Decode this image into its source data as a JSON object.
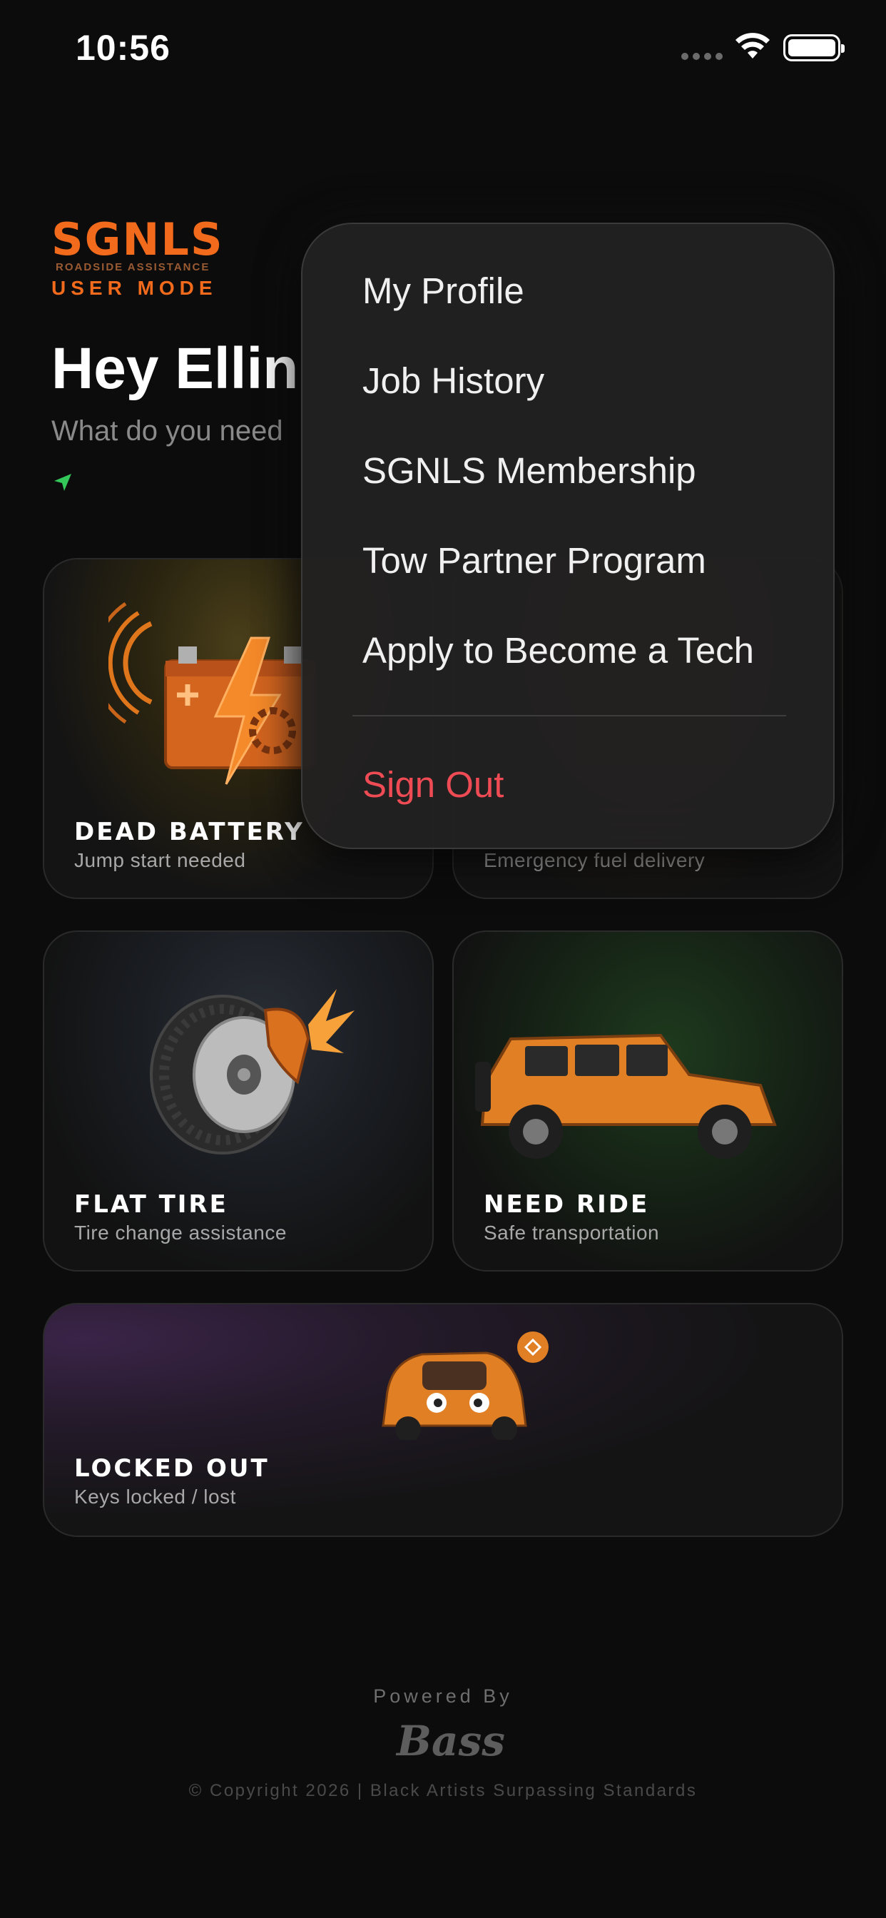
{
  "status_bar": {
    "time": "10:56"
  },
  "header": {
    "brand_name": "SGNLS",
    "brand_tagline": "ROADSIDE ASSISTANCE",
    "mode_label": "USER MODE",
    "greeting": "Hey Ellin",
    "prompt": "What do you need"
  },
  "services": [
    {
      "title": "DEAD BATTERY",
      "subtitle": "Jump start needed"
    },
    {
      "title": "",
      "subtitle": "Emergency fuel delivery"
    },
    {
      "title": "FLAT TIRE",
      "subtitle": "Tire change assistance"
    },
    {
      "title": "NEED RIDE",
      "subtitle": "Safe transportation"
    },
    {
      "title": "LOCKED OUT",
      "subtitle": "Keys locked / lost"
    }
  ],
  "menu": {
    "items": [
      "My Profile",
      "Job History",
      "SGNLS Membership",
      "Tow Partner Program",
      "Apply to Become a Tech"
    ],
    "sign_out": "Sign Out"
  },
  "footer": {
    "powered_by": "Powered By",
    "partner_logo": "Bass",
    "copyright": "© Copyright 2026 | Black Artists Surpassing Standards"
  },
  "colors": {
    "accent": "#f26a1b",
    "background": "#0c0c0c",
    "sign_out": "#ee4b55",
    "location": "#34c759"
  }
}
